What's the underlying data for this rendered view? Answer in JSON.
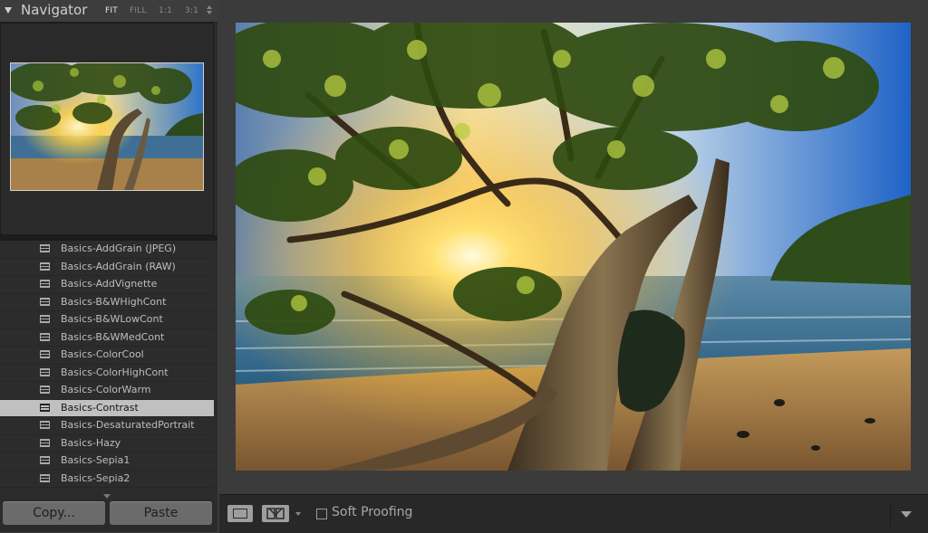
{
  "navigator": {
    "title": "Navigator",
    "zoom_options": [
      "FIT",
      "FILL",
      "1:1",
      "3:1"
    ],
    "active_zoom": "FIT"
  },
  "presets": {
    "items": [
      "Basics-AddGrain (JPEG)",
      "Basics-AddGrain (RAW)",
      "Basics-AddVignette",
      "Basics-B&WHighCont",
      "Basics-B&WLowCont",
      "Basics-B&WMedCont",
      "Basics-ColorCool",
      "Basics-ColorHighCont",
      "Basics-ColorWarm",
      "Basics-Contrast",
      "Basics-DesaturatedPortrait",
      "Basics-Hazy",
      "Basics-Sepia1",
      "Basics-Sepia2"
    ],
    "selected": "Basics-Contrast"
  },
  "buttons": {
    "copy": "Copy...",
    "paste": "Paste"
  },
  "toolbar": {
    "soft_proofing_label": "Soft Proofing",
    "soft_proofing_checked": false
  },
  "icons": {
    "collapse": "triangle-down-icon",
    "zoom_menu": "updown-arrows-icon",
    "preset": "preset-list-icon",
    "loupe": "loupe-view-icon",
    "compare": "compare-view-icon",
    "toolbar_menu": "chevron-down-icon"
  },
  "colors": {
    "panel_bg": "#2b2b2b",
    "main_bg": "#3b3b3b",
    "selected_row": "#c0c0c0",
    "button_bg": "#6b6b6b"
  }
}
